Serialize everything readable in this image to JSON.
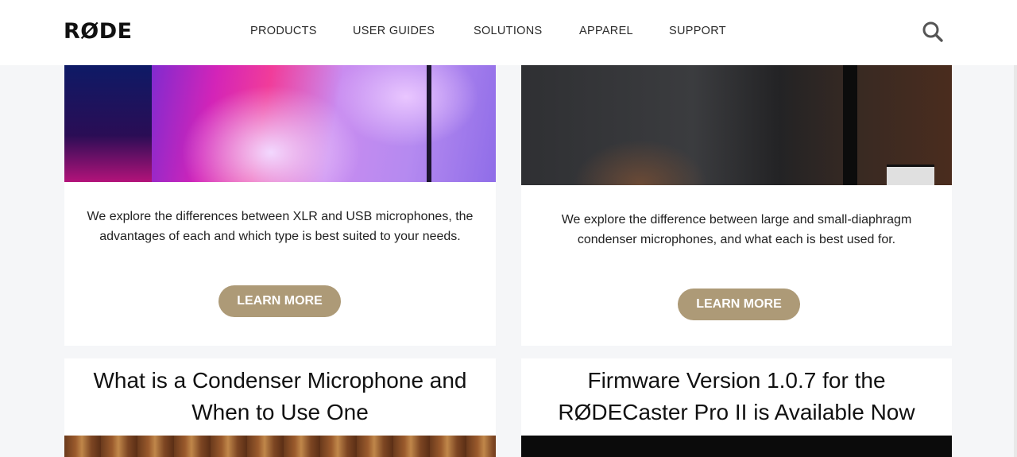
{
  "header": {
    "logo": "RØDE",
    "nav": [
      "PRODUCTS",
      "USER GUIDES",
      "SOLUTIONS",
      "APPAREL",
      "SUPPORT"
    ],
    "search_icon": "search-icon"
  },
  "cards": [
    {
      "description": "We explore the differences between XLR and USB microphones, the advantages of each and which type is best suited to your needs.",
      "button": "LEARN MORE"
    },
    {
      "description": "We explore the difference between large and small-diaphragm condenser microphones, and what each is best used for.",
      "button": "LEARN MORE"
    },
    {
      "title": "What is a Condenser Microphone and When to Use One"
    },
    {
      "title": "Firmware Version 1.0.7 for the RØDECaster Pro II is Available Now"
    }
  ],
  "colors": {
    "button_bg": "#ad9a77",
    "page_bg": "#f5f6f8"
  }
}
